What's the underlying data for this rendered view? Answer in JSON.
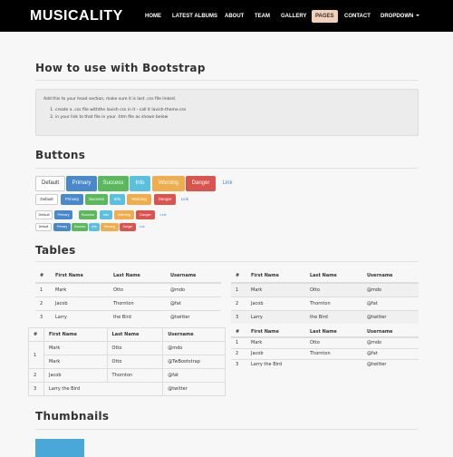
{
  "navbar": {
    "brand": "MUSICALITY",
    "items": [
      "HOME",
      "LATEST ALBUMS",
      "ABOUT",
      "TEAM",
      "GALLERY",
      "PAGES",
      "CONTACT",
      "DROPDOWN"
    ],
    "active": "PAGES"
  },
  "bootstrap_section": {
    "title": "How to use with Bootstrap",
    "intro": "Add this to your head section, make sure it is last .css file linked.",
    "steps": [
      "create a .css file withthe lavish css in it - call it lavish-theme.css",
      "in your link to that file in your .htm file as shown below"
    ]
  },
  "buttons_section": {
    "title": "Buttons",
    "labels": [
      "Default",
      "Primary",
      "Success",
      "Info",
      "Warning",
      "Danger",
      "Link"
    ]
  },
  "tables_section": {
    "title": "Tables",
    "headers": [
      "#",
      "First Name",
      "Last Name",
      "Username"
    ],
    "rows_simple": [
      [
        "1",
        "Mark",
        "Otto",
        "@mdo"
      ],
      [
        "2",
        "Jacob",
        "Thornton",
        "@fat"
      ],
      [
        "3",
        "Larry",
        "the Bird",
        "@twitter"
      ]
    ],
    "rows_bordered": [
      [
        "1",
        "Mark",
        "Otto",
        "@mdo"
      ],
      [
        "",
        "Mark",
        "Otto",
        "@TwBootstrap"
      ],
      [
        "2",
        "Jacob",
        "Thornton",
        "@fat"
      ],
      [
        "3",
        "Larry the Bird",
        "",
        "@twitter"
      ]
    ],
    "rows_condensed": [
      [
        "1",
        "Mark",
        "Otto",
        "@mdo"
      ],
      [
        "2",
        "Jacob",
        "Thornton",
        "@fat"
      ],
      [
        "3",
        "Larry the Bird",
        "",
        "@twitter"
      ]
    ]
  },
  "thumbnails_section": {
    "title": "Thumbnails"
  }
}
